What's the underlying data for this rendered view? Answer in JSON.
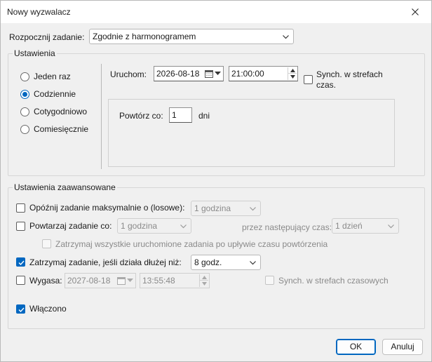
{
  "window": {
    "title": "Nowy wyzwalacz"
  },
  "begin_task": {
    "label": "Rozpocznij zadanie:",
    "value": "Zgodnie z harmonogramem"
  },
  "settings": {
    "title": "Ustawienia",
    "schedule_options": [
      {
        "label": "Jeden raz",
        "selected": false
      },
      {
        "label": "Codziennie",
        "selected": true
      },
      {
        "label": "Cotygodniowo",
        "selected": false
      },
      {
        "label": "Comiesięcznie",
        "selected": false
      }
    ],
    "start_label": "Uruchom:",
    "start_date": "2026-08-18",
    "start_time": "21:00:00",
    "sync_label_line1": "Synch. w strefach",
    "sync_label_line2": "czas.",
    "repeat_every_label": "Powtórz co:",
    "repeat_every_value": "1",
    "repeat_every_unit": "dni"
  },
  "advanced": {
    "title": "Ustawienia zaawansowane",
    "delay": {
      "label": "Opóźnij zadanie maksymalnie o (losowe):",
      "value": "1 godzina",
      "checked": false
    },
    "repeat": {
      "label": "Powtarzaj zadanie co:",
      "value": "1 godzina",
      "checked": false,
      "duration_label": "przez następujący czas:",
      "duration_value": "1 dzień"
    },
    "stop_running": {
      "label": "Zatrzymaj wszystkie uruchomione zadania po upływie czasu powtórzenia",
      "checked": false
    },
    "stop_if_longer": {
      "label": "Zatrzymaj zadanie, jeśli działa dłużej niż:",
      "value": "8 godz.",
      "checked": true
    },
    "expire": {
      "label": "Wygasa:",
      "date": "2027-08-18",
      "time": "13:55:48",
      "checked": false,
      "sync_label": "Synch. w strefach czasowych"
    },
    "enabled": {
      "label": "Włączono",
      "checked": true
    }
  },
  "buttons": {
    "ok": "OK",
    "cancel": "Anuluj"
  },
  "colors": {
    "accent": "#0067c0",
    "window_bg": "#f0f0f0",
    "disabled_text": "#8a8a8a"
  }
}
